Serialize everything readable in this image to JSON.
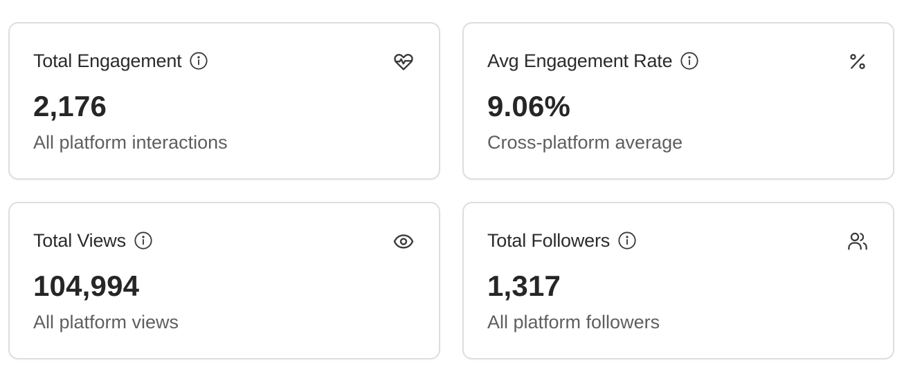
{
  "cards": [
    {
      "title": "Total Engagement",
      "value": "2,176",
      "subtitle": "All platform interactions",
      "icon": "heart-pulse-icon"
    },
    {
      "title": "Avg Engagement Rate",
      "value": "9.06%",
      "subtitle": "Cross-platform average",
      "icon": "percent-icon"
    },
    {
      "title": "Total Views",
      "value": "104,994",
      "subtitle": "All platform views",
      "icon": "eye-icon"
    },
    {
      "title": "Total Followers",
      "value": "1,317",
      "subtitle": "All platform followers",
      "icon": "users-icon"
    }
  ],
  "colors": {
    "border": "#dedede",
    "title": "#2b2b2b",
    "value": "#262626",
    "subtitle": "#5e5e5e",
    "icon": "#3a3a3a"
  }
}
